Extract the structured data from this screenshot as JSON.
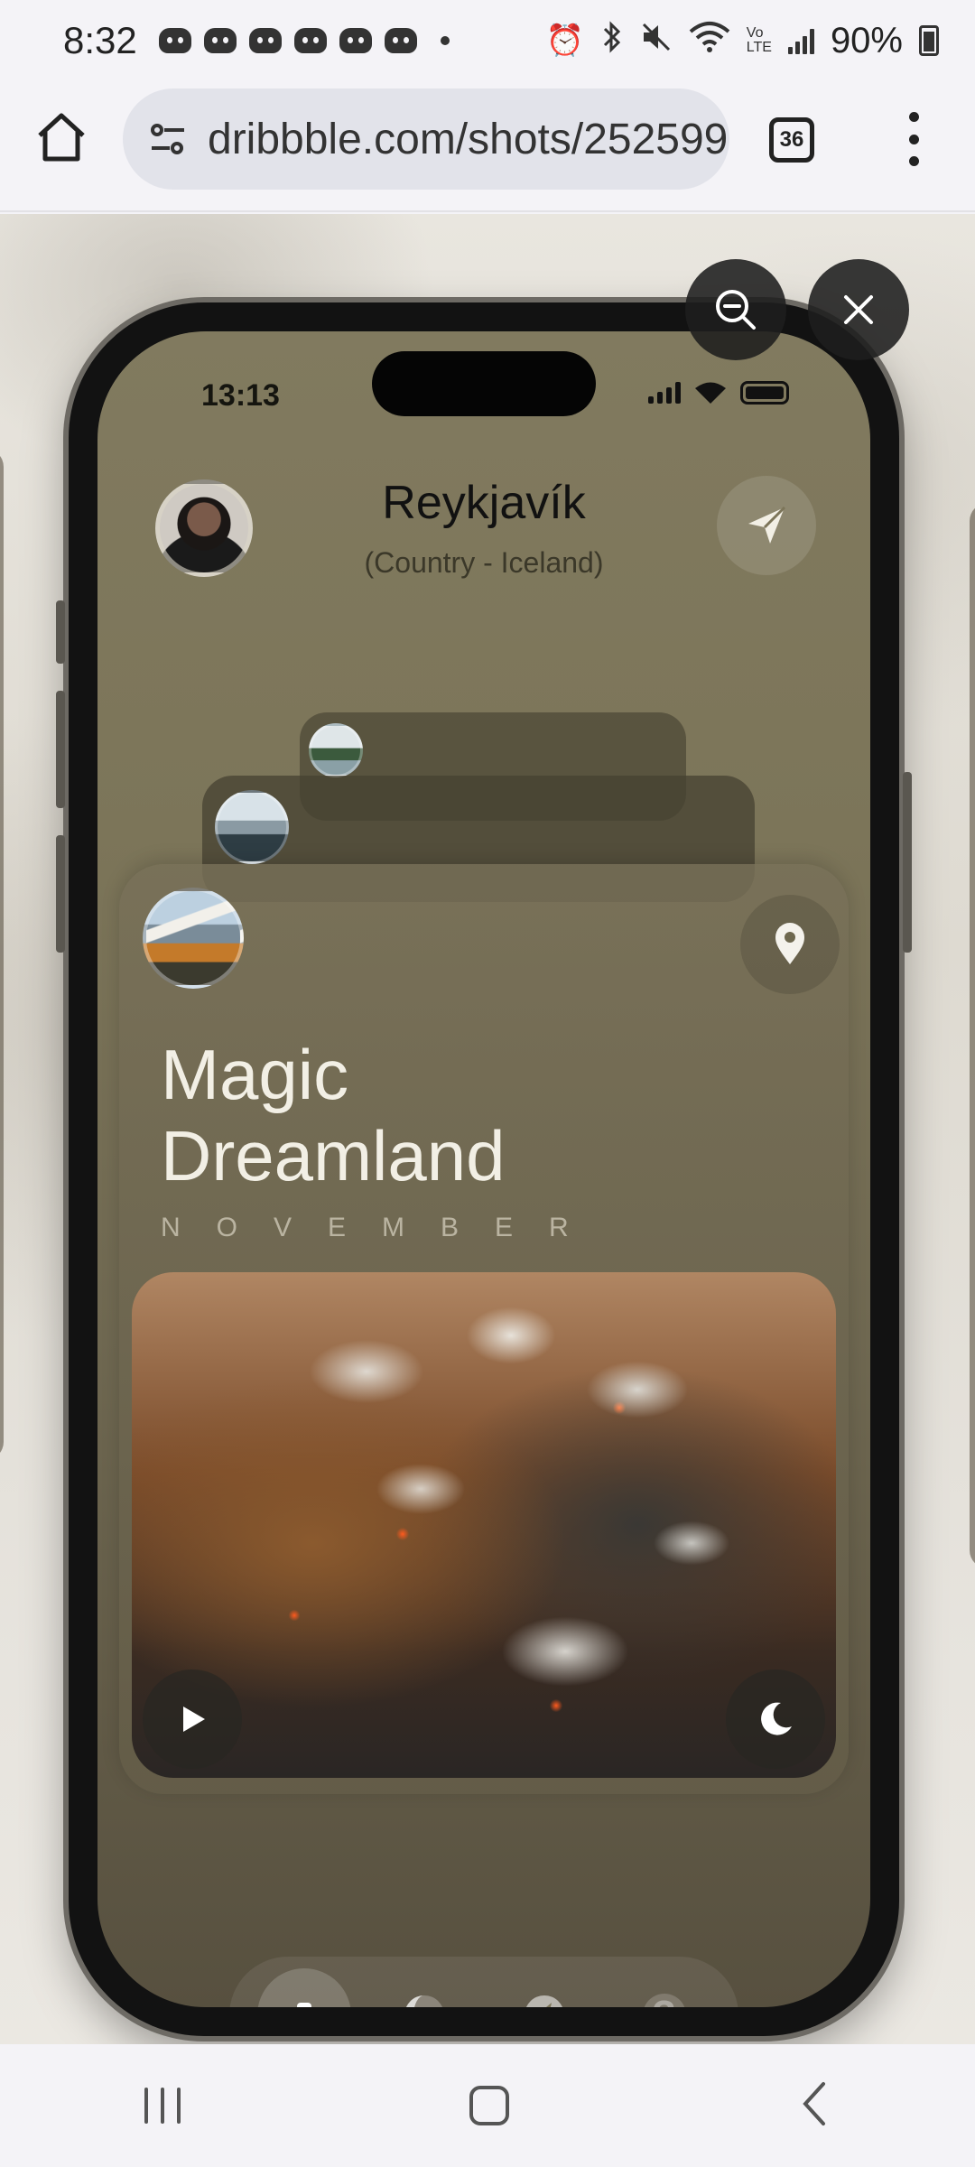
{
  "status_bar": {
    "time": "8:32",
    "battery": "90%",
    "icons": [
      "discord-icon",
      "discord-icon",
      "discord-icon",
      "discord-icon",
      "discord-icon",
      "discord-icon",
      "alarm-icon",
      "bluetooth-icon",
      "mute-icon",
      "wifi-icon",
      "volte-icon",
      "signal-icon",
      "battery-icon"
    ]
  },
  "browser": {
    "url": "dribbble.com/shots/252599",
    "tab_count": "36"
  },
  "viewer": {
    "zoom_icon": "zoom-out-icon",
    "close_icon": "close-icon"
  },
  "app": {
    "ios_time": "13:13",
    "city": "Reykjavík",
    "country": "(Country - Iceland)",
    "card": {
      "title_line1": "Magic",
      "title_line2": "Dreamland",
      "month": "NOVEMBER"
    },
    "tabs": [
      {
        "icon": "binoculars-icon",
        "active": true
      },
      {
        "icon": "moon-phase-icon",
        "active": false
      },
      {
        "icon": "compass-icon",
        "active": false
      },
      {
        "icon": "help-icon",
        "label": "?",
        "active": false
      }
    ]
  },
  "colors": {
    "app_olive": "#7c7559",
    "card_text": "#f2efe5",
    "chrome_bg": "#f4f3f7"
  }
}
